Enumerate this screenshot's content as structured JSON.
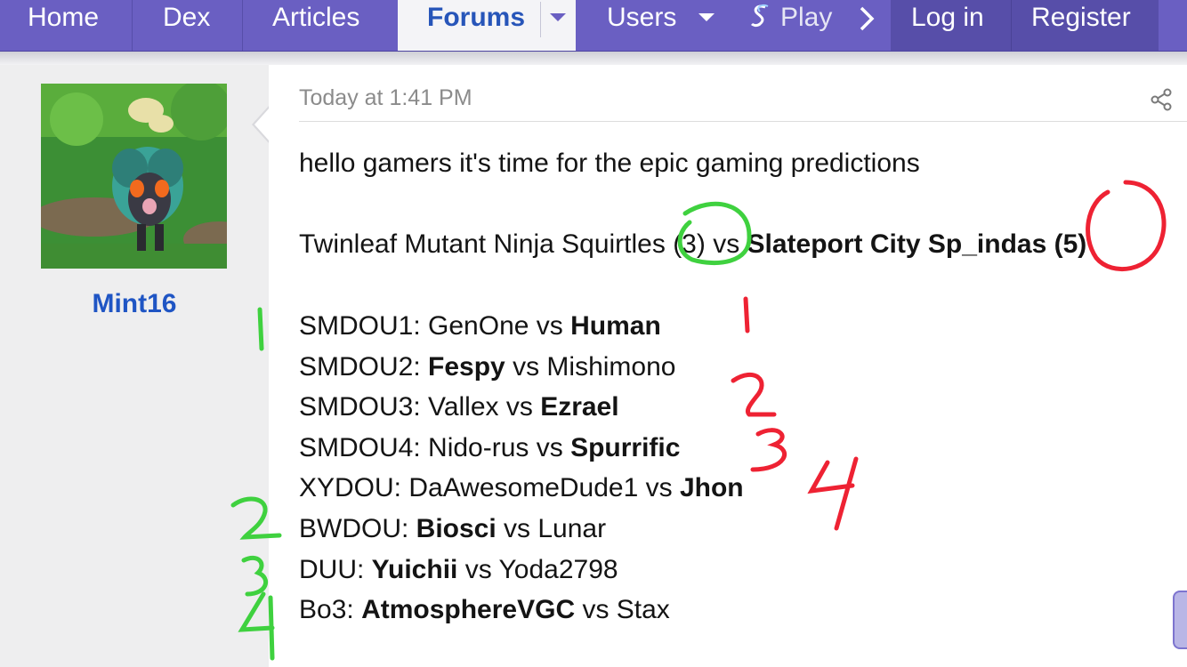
{
  "nav": {
    "home": "Home",
    "dex": "Dex",
    "articles": "Articles",
    "forums": "Forums",
    "users": "Users",
    "play": "Play",
    "login": "Log in",
    "register": "Register"
  },
  "author": {
    "username": "Mint16"
  },
  "post": {
    "timestamp": "Today at 1:41 PM",
    "intro": "hello gamers it's time for the epic gaming predictions",
    "matchup": {
      "team_a": "Twinleaf Mutant Ninja Squirtles (3)",
      "vs": " vs ",
      "team_b": "Slateport City Sp_indas (5)"
    },
    "games": [
      {
        "label": "SMDOU1: ",
        "p1": "GenOne",
        "vs": " vs ",
        "p2": "Human",
        "winner": "p2"
      },
      {
        "label": "SMDOU2: ",
        "p1": "Fespy",
        "vs": " vs ",
        "p2": "Mishimono",
        "winner": "p1"
      },
      {
        "label": "SMDOU3: ",
        "p1": "Vallex",
        "vs": " vs ",
        "p2": "Ezrael",
        "winner": "p2"
      },
      {
        "label": "SMDOU4: ",
        "p1": "Nido-rus",
        "vs": " vs ",
        "p2": "Spurrific",
        "winner": "p2"
      },
      {
        "label": "XYDOU: ",
        "p1": "DaAwesomeDude1",
        "vs": " vs ",
        "p2": "Jhon",
        "winner": "p2"
      },
      {
        "label": "BWDOU: ",
        "p1": "Biosci",
        "vs": " vs ",
        "p2": "Lunar",
        "winner": "p1"
      },
      {
        "label": "DUU: ",
        "p1": "Yuichii",
        "vs": " vs ",
        "p2": "Yoda2798",
        "winner": "p1"
      },
      {
        "label": "Bo3: ",
        "p1": "AtmosphereVGC",
        "vs": " vs ",
        "p2": "Stax",
        "winner": "p1"
      }
    ]
  },
  "annotations": {
    "green_marks": [
      "1",
      "2",
      "3",
      "4"
    ],
    "red_marks": [
      "1",
      "2",
      "3",
      "4"
    ]
  },
  "colors": {
    "nav_bg": "#6a5fc2",
    "active_tab_text": "#2755b9",
    "username": "#1f55c4",
    "green_ink": "#3fd13f",
    "red_ink": "#ee2233"
  }
}
